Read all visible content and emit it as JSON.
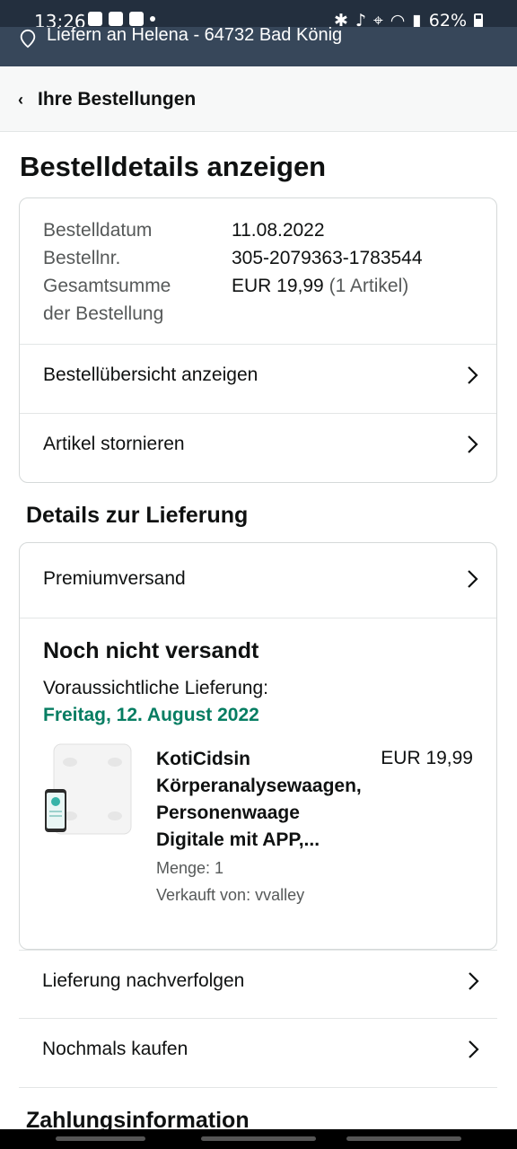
{
  "status_bar": {
    "time": "13:26",
    "battery": "62%"
  },
  "delivery_bar": {
    "text": "Liefern an Helena - 64732 Bad König"
  },
  "nav": {
    "back_label": "Ihre Bestellungen"
  },
  "page_title": "Bestelldetails anzeigen",
  "order": {
    "date_label": "Bestelldatum",
    "date_value": "11.08.2022",
    "number_label": "Bestellnr.",
    "number_value": "305-2079363-1783544",
    "total_label_1": "Gesamtsumme",
    "total_label_2": "der Bestellung",
    "total_value": "EUR 19,99",
    "total_items": "(1 Artikel)"
  },
  "order_actions": {
    "view_summary": "Bestellübersicht anzeigen",
    "cancel": "Artikel stornieren"
  },
  "delivery_section": {
    "heading": "Details zur Lieferung",
    "shipping_method": "Premiumversand",
    "status": "Noch nicht versandt",
    "estimated_label": "Voraussichtliche Lieferung:",
    "estimated_date": "Freitag, 12. August 2022",
    "date_color": "#067d62"
  },
  "product": {
    "name_line1": "KotiCidsin",
    "name_line2": "Körperanalysewaagen,",
    "name_line3": "Personenwaage",
    "name_line4": "Digitale mit APP,...",
    "price": "EUR 19,99",
    "quantity": "Menge: 1",
    "seller": "Verkauft von: vvalley"
  },
  "more_actions": {
    "track": "Lieferung nachverfolgen",
    "buy_again": "Nochmals kaufen"
  },
  "payment_heading": "Zahlungsinformation"
}
